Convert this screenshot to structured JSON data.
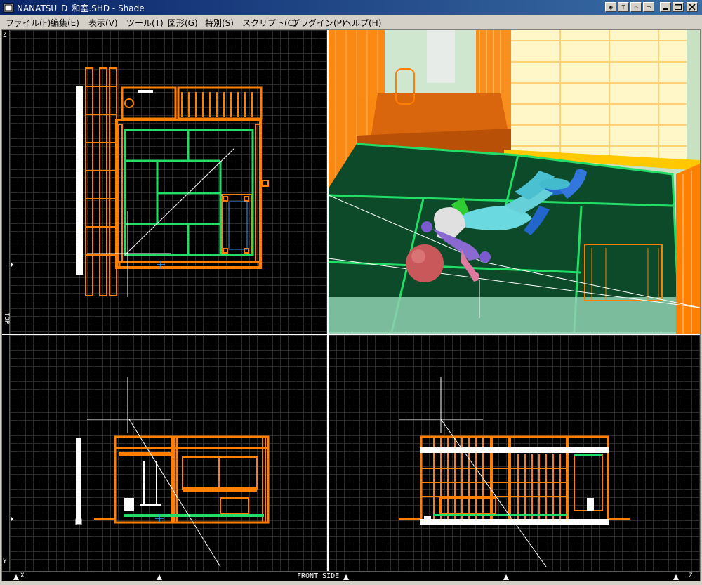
{
  "window": {
    "title": "NANATSU_D_和室.SHD - Shade",
    "controls": [
      "◉",
      "⊤",
      "⇒",
      "▭"
    ]
  },
  "menu": [
    "ファイル(F)",
    "編集(E)",
    "表示(V)",
    "ツール(T)",
    "図形(G)",
    "特別(S)",
    "スクリプト(C)",
    "プラグイン(P)",
    "ヘルプ(H)"
  ],
  "axes": {
    "top_left_axis": "Z",
    "top_label": "TOP",
    "bottom_left_axis": "Y",
    "bottom_x": "X",
    "bottom_z": "Z",
    "front_side": "FRONT SIDE"
  },
  "colors": {
    "orange": "#ff7f00",
    "green": "#22dd66",
    "tatami": "#0d4a2a",
    "white": "#ffffff",
    "grid": "#2a2a2a"
  }
}
